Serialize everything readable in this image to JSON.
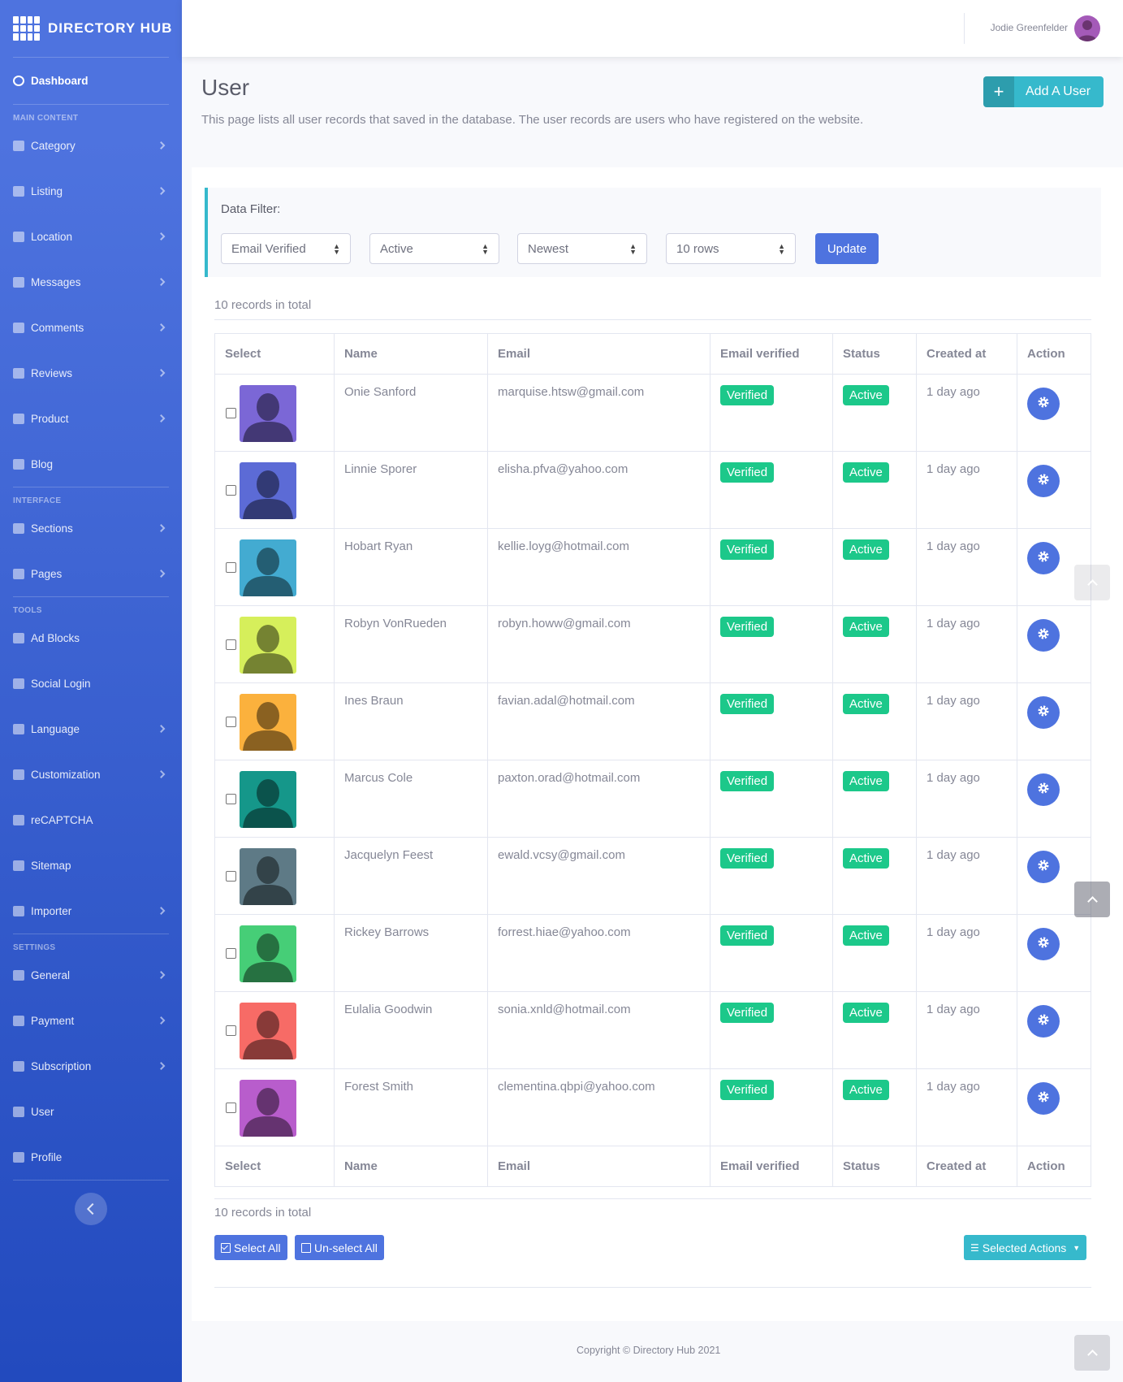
{
  "brand": {
    "name": "DIRECTORY HUB"
  },
  "sidebar": {
    "dashboard": "Dashboard",
    "headings": {
      "main": "MAIN CONTENT",
      "interface": "INTERFACE",
      "tools": "TOOLS",
      "settings": "SETTINGS"
    },
    "main_items": [
      {
        "label": "Category",
        "icon": "th-large-icon"
      },
      {
        "label": "Listing",
        "icon": "flag-icon"
      },
      {
        "label": "Location",
        "icon": "map-icon"
      },
      {
        "label": "Messages",
        "icon": "comments-icon"
      },
      {
        "label": "Comments",
        "icon": "comment-icon"
      },
      {
        "label": "Reviews",
        "icon": "star-icon"
      },
      {
        "label": "Product",
        "icon": "handshake-icon"
      },
      {
        "label": "Blog",
        "icon": "edit-icon"
      }
    ],
    "interface_items": [
      {
        "label": "Sections",
        "icon": "bars-icon"
      },
      {
        "label": "Pages",
        "icon": "copy-icon"
      }
    ],
    "tools_items": [
      {
        "label": "Ad Blocks",
        "icon": "ad-icon"
      },
      {
        "label": "Social Login",
        "icon": "share-icon"
      },
      {
        "label": "Language",
        "icon": "language-icon"
      },
      {
        "label": "Customization",
        "icon": "tools-icon"
      },
      {
        "label": "reCAPTCHA",
        "icon": "check-icon"
      },
      {
        "label": "Sitemap",
        "icon": "sitemap-icon"
      },
      {
        "label": "Importer",
        "icon": "file-import-icon"
      }
    ],
    "settings_items": [
      {
        "label": "General",
        "icon": "cog-icon"
      },
      {
        "label": "Payment",
        "icon": "credit-card-icon"
      },
      {
        "label": "Subscription",
        "icon": "tags-icon"
      },
      {
        "label": "User",
        "icon": "user-cog-icon"
      },
      {
        "label": "Profile",
        "icon": "id-card-icon"
      }
    ]
  },
  "topbar": {
    "user_name": "Jodie Greenfelder"
  },
  "page": {
    "title": "User",
    "description": "This page lists all user records that saved in the database. The user records are users who have registered on the website.",
    "add_button": "Add A User"
  },
  "filter": {
    "title": "Data Filter:",
    "email_verified": "Email Verified",
    "status": "Active",
    "order": "Newest",
    "rows": "10 rows",
    "update": "Update"
  },
  "records_total": "10 records in total",
  "table": {
    "headers": [
      "Select",
      "Name",
      "Email",
      "Email verified",
      "Status",
      "Created at",
      "Action"
    ],
    "rows": [
      {
        "name": "Onie Sanford",
        "email": "marquise.htsw@gmail.com",
        "verified": "Verified",
        "status": "Active",
        "created": "1 day ago",
        "color": "#7b67d6"
      },
      {
        "name": "Linnie Sporer",
        "email": "elisha.pfva@yahoo.com",
        "verified": "Verified",
        "status": "Active",
        "created": "1 day ago",
        "color": "#5c6bd6"
      },
      {
        "name": "Hobart Ryan",
        "email": "kellie.loyg@hotmail.com",
        "verified": "Verified",
        "status": "Active",
        "created": "1 day ago",
        "color": "#43abd1"
      },
      {
        "name": "Robyn VonRueden",
        "email": "robyn.howw@gmail.com",
        "verified": "Verified",
        "status": "Active",
        "created": "1 day ago",
        "color": "#d6ef5b"
      },
      {
        "name": "Ines Braun",
        "email": "favian.adal@hotmail.com",
        "verified": "Verified",
        "status": "Active",
        "created": "1 day ago",
        "color": "#fbb13d"
      },
      {
        "name": "Marcus Cole",
        "email": "paxton.orad@hotmail.com",
        "verified": "Verified",
        "status": "Active",
        "created": "1 day ago",
        "color": "#15978a"
      },
      {
        "name": "Jacquelyn Feest",
        "email": "ewald.vcsy@gmail.com",
        "verified": "Verified",
        "status": "Active",
        "created": "1 day ago",
        "color": "#5e7a86"
      },
      {
        "name": "Rickey Barrows",
        "email": "forrest.hiae@yahoo.com",
        "verified": "Verified",
        "status": "Active",
        "created": "1 day ago",
        "color": "#46ce77"
      },
      {
        "name": "Eulalia Goodwin",
        "email": "sonia.xnld@hotmail.com",
        "verified": "Verified",
        "status": "Active",
        "created": "1 day ago",
        "color": "#f76b66"
      },
      {
        "name": "Forest Smith",
        "email": "clementina.qbpi@yahoo.com",
        "verified": "Verified",
        "status": "Active",
        "created": "1 day ago",
        "color": "#b85dcc"
      }
    ]
  },
  "bulk": {
    "select_all": "Select All",
    "unselect_all": "Un-select All",
    "selected_actions": "Selected Actions"
  },
  "footer": {
    "copyright": "Copyright © Directory Hub 2021"
  },
  "colors": {
    "primary": "#4e73df",
    "info": "#36b9cc",
    "success": "#1cc88a"
  }
}
